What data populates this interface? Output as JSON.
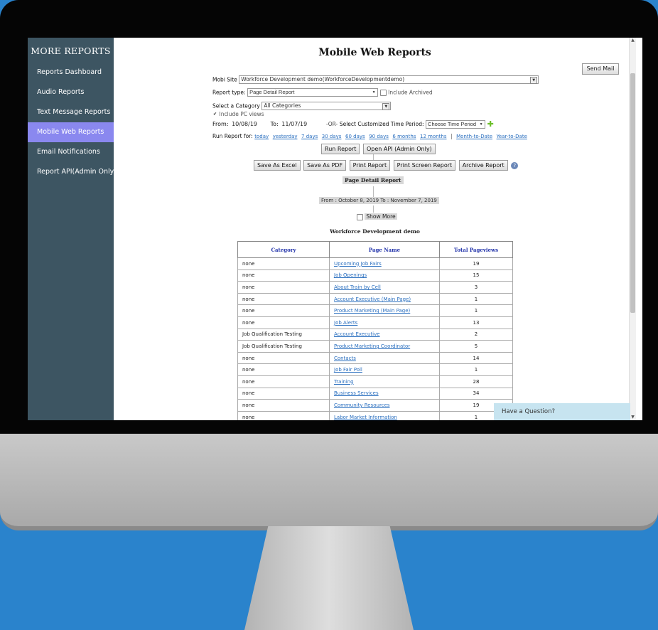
{
  "sidebar": {
    "title": "MORE REPORTS",
    "items": [
      {
        "label": "Reports Dashboard",
        "active": false
      },
      {
        "label": "Audio Reports",
        "active": false
      },
      {
        "label": "Text Message Reports",
        "active": false
      },
      {
        "label": "Mobile Web Reports",
        "active": true
      },
      {
        "label": "Email Notifications",
        "active": false
      },
      {
        "label": "Report API(Admin Only)",
        "active": false
      }
    ]
  },
  "header": {
    "title": "Mobile Web Reports",
    "send_mail": "Send Mail"
  },
  "filters": {
    "mobi_site_label": "Mobi Site",
    "mobi_site_value": "Workforce Development demo(WorkforceDevelopmentdemo)",
    "report_type_label": "Report type:",
    "report_type_value": "Page Detail Report",
    "include_archived": "Include Archived",
    "category_label": "Select a Category",
    "category_value": "All Categories",
    "include_pc_views": "Include PC views",
    "from_label": "From:",
    "from_value": "10/08/19",
    "to_label": "To:",
    "to_value": "11/07/19",
    "or_label": "-OR-",
    "period_label": "Select Customized Time Period:",
    "period_value": "Choose Time Period",
    "run_for_label": "Run Report for:",
    "quick_ranges": [
      "today",
      "yesterday",
      "7 days",
      "30 days",
      "60 days",
      "90 days",
      "6 months",
      "12 months"
    ],
    "separator": "|",
    "quick_ranges_2": [
      "Month-to-Date",
      "Year-to-Date"
    ]
  },
  "actions": {
    "run_report": "Run Report",
    "open_api": "Open API (Admin Only)",
    "export_buttons": [
      "Save As Excel",
      "Save As PDF",
      "Print Report",
      "Print Screen Report",
      "Archive Report"
    ]
  },
  "report": {
    "title": "Page Detail Report",
    "range": "From : October 8, 2019 To : November 7, 2019",
    "show_more": "Show More",
    "site_name": "Workforce Development demo",
    "columns": [
      "Category",
      "Page Name",
      "Total Pageviews"
    ],
    "rows": [
      {
        "category": "none",
        "page": "Upcoming Job Fairs",
        "views": "19"
      },
      {
        "category": "none",
        "page": "Job Openings",
        "views": "15"
      },
      {
        "category": "none",
        "page": "About Train by Cell",
        "views": "3"
      },
      {
        "category": "none",
        "page": "Account Executive (Main Page)",
        "views": "1"
      },
      {
        "category": "none",
        "page": "Product Marketing (Main Page)",
        "views": "1"
      },
      {
        "category": "none",
        "page": "Job Alerts",
        "views": "13"
      },
      {
        "category": "Job Qualification Testing",
        "page": "Account Executive",
        "views": "2"
      },
      {
        "category": "Job Qualification Testing",
        "page": "Product Marketing Coordinator",
        "views": "5"
      },
      {
        "category": "none",
        "page": "Contacts",
        "views": "14"
      },
      {
        "category": "none",
        "page": "Job Fair Poll",
        "views": "1"
      },
      {
        "category": "none",
        "page": "Training",
        "views": "28"
      },
      {
        "category": "none",
        "page": "Business Services",
        "views": "34"
      },
      {
        "category": "none",
        "page": "Community Resources",
        "views": "19"
      },
      {
        "category": "none",
        "page": "Labor Market Information",
        "views": "1"
      }
    ]
  },
  "chat": {
    "label": "Have a Question?"
  }
}
